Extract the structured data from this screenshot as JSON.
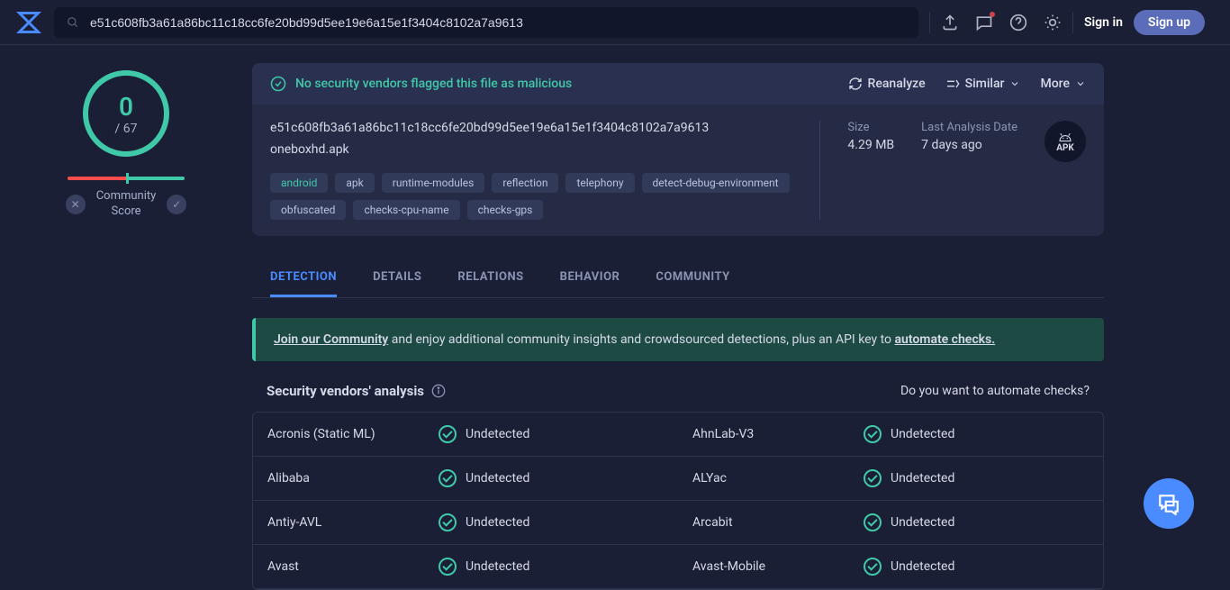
{
  "search": {
    "value": "e51c608fb3a61a86bc11c18cc6fe20bd99d5ee19e6a15e1f3404c8102a7a9613"
  },
  "auth": {
    "signin": "Sign in",
    "signup": "Sign up"
  },
  "score": {
    "detected": "0",
    "total": "/ 67",
    "community_label": "Community\nScore"
  },
  "flag": {
    "text": "No security vendors flagged this file as malicious"
  },
  "actions": {
    "reanalyze": "Reanalyze",
    "similar": "Similar",
    "more": "More"
  },
  "file": {
    "hash": "e51c608fb3a61a86bc11c18cc6fe20bd99d5ee19e6a15e1f3404c8102a7a9613",
    "name": "oneboxhd.apk",
    "size_label": "Size",
    "size_value": "4.29 MB",
    "date_label": "Last Analysis Date",
    "date_value": "7 days ago",
    "badge": "APK"
  },
  "tags": [
    "android",
    "apk",
    "runtime-modules",
    "reflection",
    "telephony",
    "detect-debug-environment",
    "obfuscated",
    "checks-cpu-name",
    "checks-gps"
  ],
  "tabs": [
    "DETECTION",
    "DETAILS",
    "RELATIONS",
    "BEHAVIOR",
    "COMMUNITY"
  ],
  "banner": {
    "link1": "Join our Community",
    "mid": " and enjoy additional community insights and crowdsourced detections, plus an API key to ",
    "link2": "automate checks."
  },
  "analysis": {
    "title": "Security vendors' analysis",
    "automate": "Do you want to automate checks?"
  },
  "vendors": [
    {
      "left": {
        "name": "Acronis (Static ML)",
        "status": "Undetected"
      },
      "right": {
        "name": "AhnLab-V3",
        "status": "Undetected"
      }
    },
    {
      "left": {
        "name": "Alibaba",
        "status": "Undetected"
      },
      "right": {
        "name": "ALYac",
        "status": "Undetected"
      }
    },
    {
      "left": {
        "name": "Antiy-AVL",
        "status": "Undetected"
      },
      "right": {
        "name": "Arcabit",
        "status": "Undetected"
      }
    },
    {
      "left": {
        "name": "Avast",
        "status": "Undetected"
      },
      "right": {
        "name": "Avast-Mobile",
        "status": "Undetected"
      }
    }
  ]
}
